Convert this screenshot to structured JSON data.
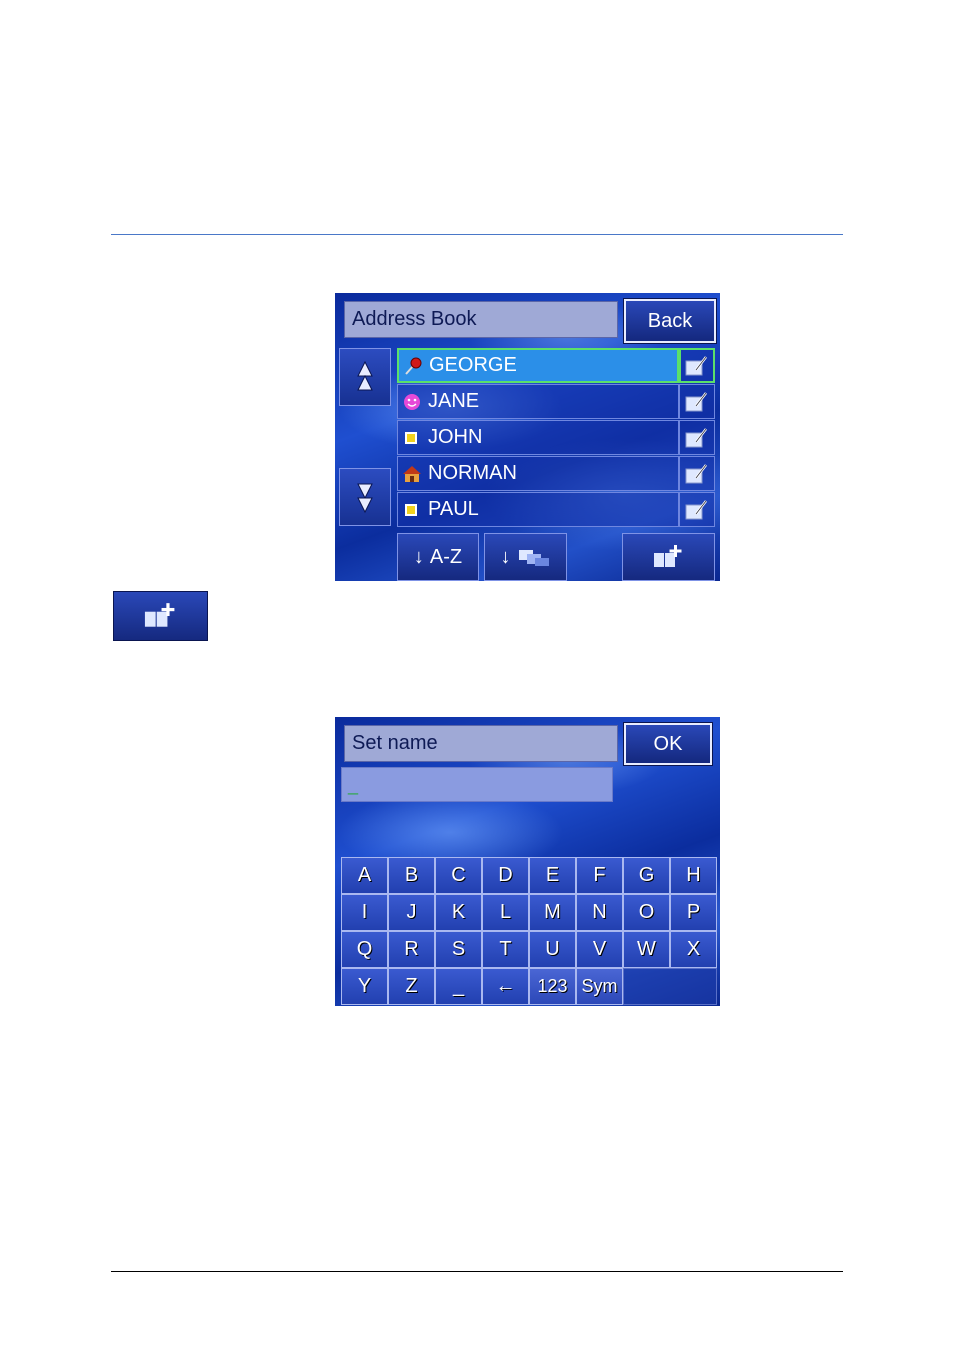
{
  "address_book": {
    "title": "Address Book",
    "back_label": "Back",
    "contacts": [
      {
        "name": "GEORGE",
        "icon": "pin-icon",
        "selected": true
      },
      {
        "name": "JANE",
        "icon": "smiley-icon",
        "selected": false
      },
      {
        "name": "JOHN",
        "icon": "yellow-square-icon",
        "selected": false
      },
      {
        "name": "NORMAN",
        "icon": "house-icon",
        "selected": false
      },
      {
        "name": "PAUL",
        "icon": "yellow-square-icon",
        "selected": false
      }
    ],
    "sort_az_label": "A-Z",
    "sort_arrow": "↓"
  },
  "set_name": {
    "title": "Set name",
    "ok_label": "OK",
    "input_value": "_",
    "keys": [
      [
        "A",
        "B",
        "C",
        "D",
        "E",
        "F",
        "G",
        "H"
      ],
      [
        "I",
        "J",
        "K",
        "L",
        "M",
        "N",
        "O",
        "P"
      ],
      [
        "Q",
        "R",
        "S",
        "T",
        "U",
        "V",
        "W",
        "X"
      ],
      [
        "Y",
        "Z",
        "_",
        "←",
        "123",
        "Sym"
      ]
    ]
  },
  "colors": {
    "selected_row": "#2b8fe8",
    "selected_border": "#5be06a",
    "screen_blue": "#1f4fd0"
  }
}
